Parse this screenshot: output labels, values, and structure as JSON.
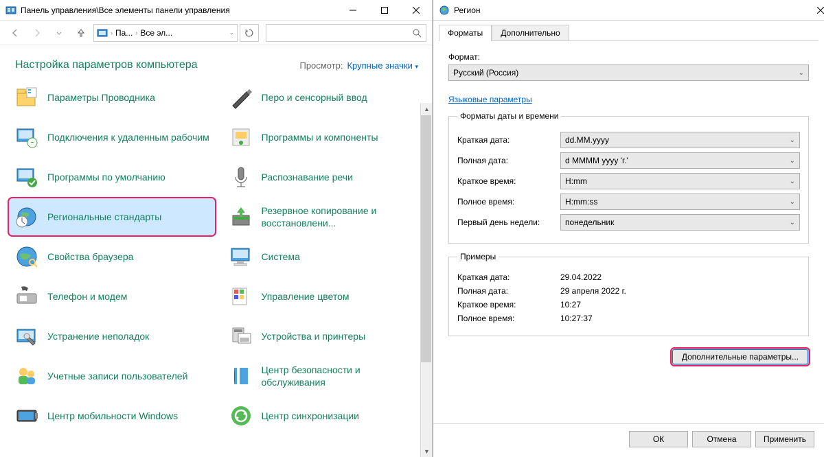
{
  "cp": {
    "title": "Панель управления\\Все элементы панели управления",
    "breadcrumb": {
      "seg1": "Па...",
      "seg2": "Все эл..."
    },
    "header": "Настройка параметров компьютера",
    "view_label": "Просмотр:",
    "view_value": "Крупные значки",
    "items": [
      {
        "label": "Параметры Проводника",
        "icon": "folder-options"
      },
      {
        "label": "Перо и сенсорный ввод",
        "icon": "pen"
      },
      {
        "label": "Подключения к удаленным рабочим",
        "icon": "remote"
      },
      {
        "label": "Программы и компоненты",
        "icon": "programs"
      },
      {
        "label": "Программы по умолчанию",
        "icon": "defaults"
      },
      {
        "label": "Распознавание речи",
        "icon": "speech"
      },
      {
        "label": "Региональные стандарты",
        "icon": "region",
        "selected": true,
        "highlighted": true
      },
      {
        "label": "Резервное копирование и восстановлени...",
        "icon": "backup"
      },
      {
        "label": "Свойства браузера",
        "icon": "browser"
      },
      {
        "label": "Система",
        "icon": "system"
      },
      {
        "label": "Телефон и модем",
        "icon": "phone"
      },
      {
        "label": "Управление цветом",
        "icon": "color"
      },
      {
        "label": "Устранение неполадок",
        "icon": "troubleshoot"
      },
      {
        "label": "Устройства и принтеры",
        "icon": "devices"
      },
      {
        "label": "Учетные записи пользователей",
        "icon": "users"
      },
      {
        "label": "Центр безопасности и обслуживания",
        "icon": "security"
      },
      {
        "label": "Центр мобильности Windows",
        "icon": "mobility"
      },
      {
        "label": "Центр синхронизации",
        "icon": "sync"
      }
    ]
  },
  "dlg": {
    "title": "Регион",
    "tabs": {
      "t1": "Форматы",
      "t2": "Дополнительно"
    },
    "format_label": "Формат:",
    "format_value": "Русский (Россия)",
    "lang_link": "Языковые параметры",
    "box1_title": "Форматы даты и времени",
    "rows": {
      "r1l": "Краткая дата:",
      "r1v": "dd.MM.yyyy",
      "r2l": "Полная дата:",
      "r2v": "d MMMM yyyy 'г.'",
      "r3l": "Краткое время:",
      "r3v": "H:mm",
      "r4l": "Полное время:",
      "r4v": "H:mm:ss",
      "r5l": "Первый день недели:",
      "r5v": "понедельник"
    },
    "box2_title": "Примеры",
    "ex": {
      "e1l": "Краткая дата:",
      "e1v": "29.04.2022",
      "e2l": "Полная дата:",
      "e2v": "29 апреля 2022 г.",
      "e3l": "Краткое время:",
      "e3v": "10:27",
      "e4l": "Полное время:",
      "e4v": "10:27:37"
    },
    "extra_btn": "Дополнительные параметры...",
    "ok": "ОК",
    "cancel": "Отмена",
    "apply": "Применить"
  }
}
